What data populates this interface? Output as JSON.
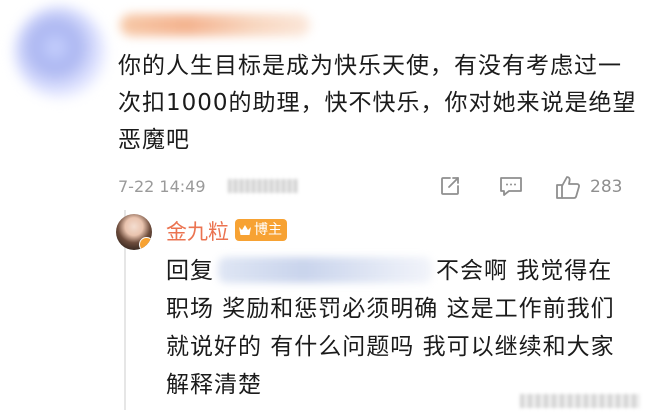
{
  "comment": {
    "text": "你的人生目标是成为快乐天使，有没有考虑过一次扣1000的助理，快不快乐，你对她来说是绝望恶魔吧",
    "timestamp": "7-22 14:49",
    "like_count": "283",
    "icons": [
      "share-icon",
      "comment-icon",
      "like-icon"
    ]
  },
  "reply": {
    "author": "金九粒",
    "badge_label": "博主",
    "reply_prefix": "回复",
    "text": "不会啊 我觉得在职场 奖励和惩罚必须明确 这是工作前我们就说好的 有什么问题吗 我可以继续和大家解释清楚"
  },
  "colors": {
    "author": "#eb7350",
    "badge": "#f7a233",
    "meta": "#9a9a9a"
  }
}
